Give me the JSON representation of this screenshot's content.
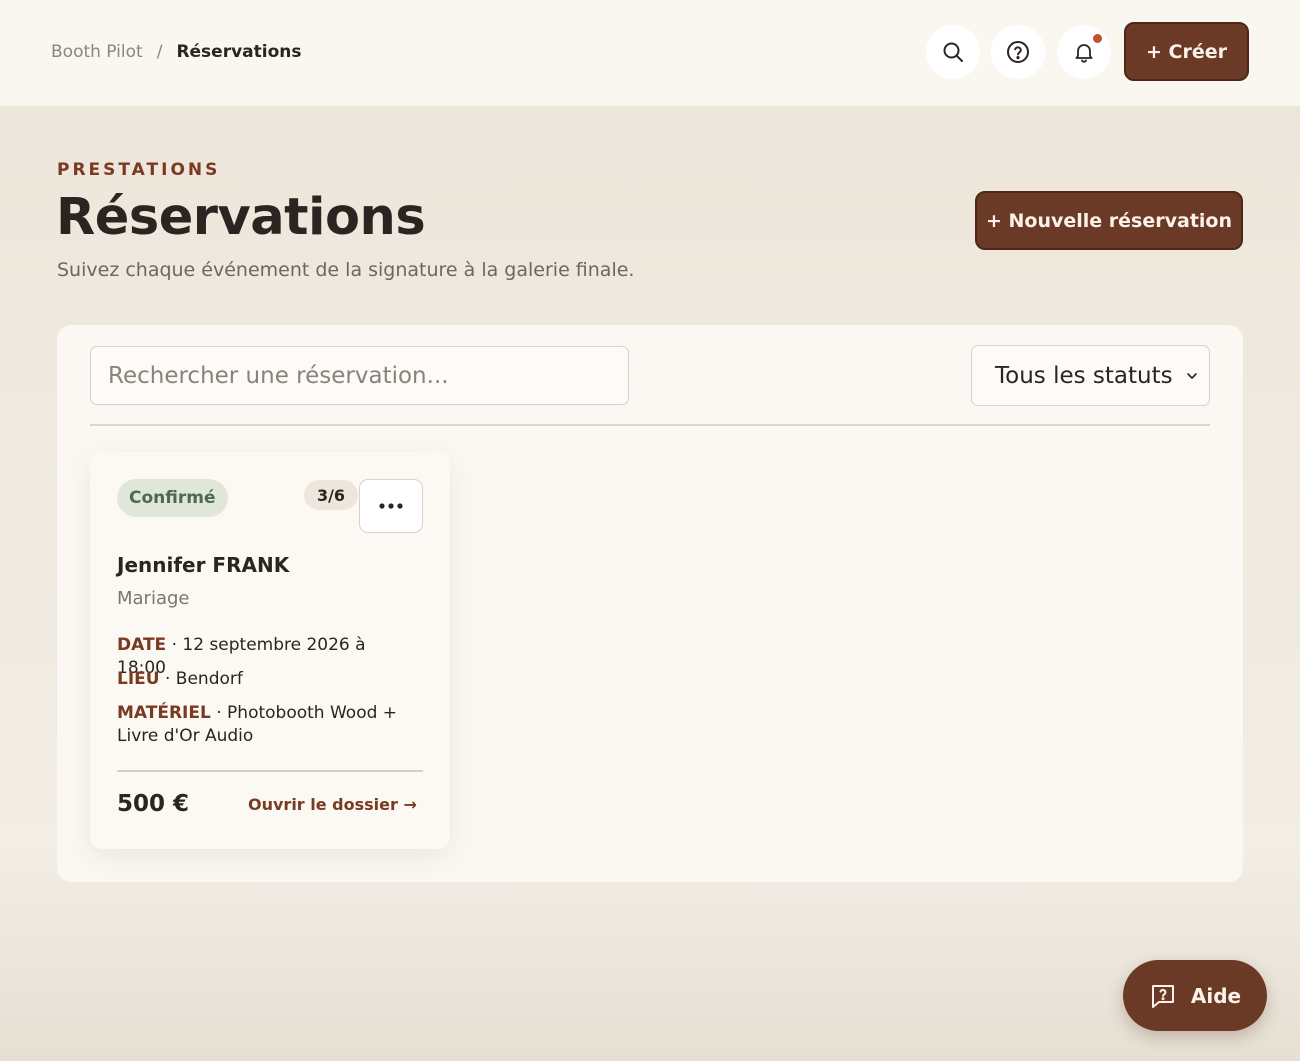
{
  "breadcrumb": {
    "root": "Booth Pilot",
    "separator": "/",
    "current": "Réservations"
  },
  "topbar": {
    "search_icon": "search-icon",
    "help_icon": "help-circle-icon",
    "notification_icon": "bell-icon",
    "create_label": "+ Créer"
  },
  "header": {
    "eyebrow": "PRESTATIONS",
    "title": "Réservations",
    "subtitle": "Suivez chaque événement de la signature à la galerie finale.",
    "new_reservation_label": "+ Nouvelle réservation"
  },
  "filters": {
    "search_placeholder": "Rechercher une réservation...",
    "status_selected": "Tous les statuts"
  },
  "reservations": [
    {
      "status": "Confirmé",
      "progress": "3/6",
      "client": "Jennifer FRANK",
      "event_type": "Mariage",
      "date_label": "DATE",
      "date_value": "12 septembre 2026 à 18:00",
      "lieu_label": "LIEU",
      "lieu_value": "Bendorf",
      "materiel_label": "MATÉRIEL",
      "materiel_value": "Photobooth Wood + Livre d'Or Audio",
      "price": "500 €",
      "open_label": "Ouvrir le dossier →"
    }
  ],
  "help_fab": {
    "label": "Aide",
    "icon": "chat-question-icon"
  },
  "colors": {
    "brand": "#6b3a26",
    "accent_text": "#7a3a22",
    "status_confirmed_bg": "#e1e6da",
    "status_confirmed_text": "#4c6b4e",
    "notification_dot": "#c2502e"
  }
}
